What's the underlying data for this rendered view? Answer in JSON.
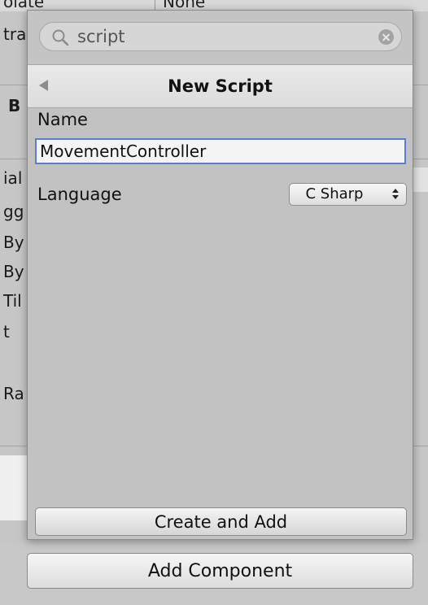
{
  "background": {
    "top_left_fragment": "olate",
    "top_right_fragment": "None",
    "labels": [
      "tra",
      "B",
      "ial",
      "gg",
      "By",
      "By",
      "Til",
      "t",
      "Ra"
    ]
  },
  "popup": {
    "search": {
      "value": "script",
      "icon": "search-icon",
      "clear_icon": "clear-icon"
    },
    "header": {
      "title": "New Script",
      "back_icon": "back-arrow-icon"
    },
    "name_label": "Name",
    "name_value": "MovementController",
    "language_label": "Language",
    "language_value": "C Sharp",
    "create_button": "Create and Add"
  },
  "add_component_button": "Add Component",
  "colors": {
    "focus_border": "#5b7bd6",
    "popup_bg": "#c2c2c2"
  }
}
